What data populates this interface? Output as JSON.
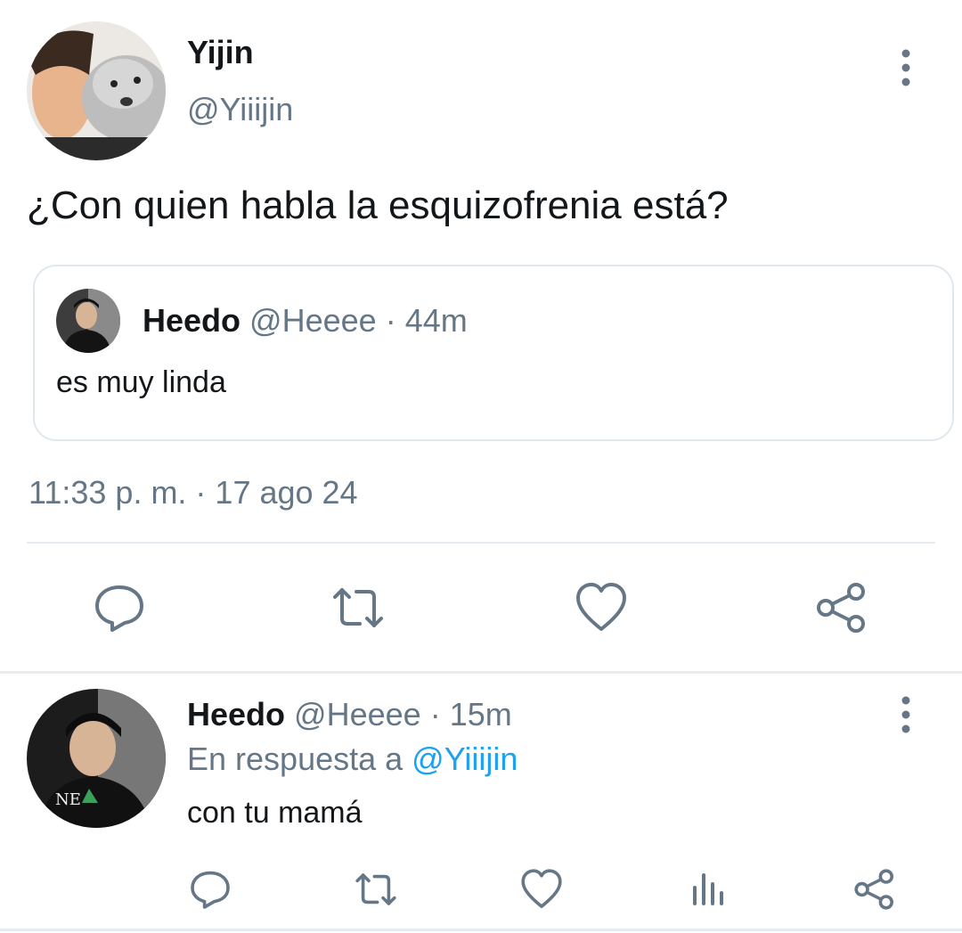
{
  "colors": {
    "text": "#14171a",
    "muted": "#657786",
    "accent": "#1da1f2",
    "border": "#e1e8ed"
  },
  "main_tweet": {
    "display_name": "Yijin",
    "handle": "@Yiiijin",
    "text": "¿Con quien habla la esquizofrenia está?",
    "timestamp": "11:33 p. m. · 17 ago 24",
    "quoted": {
      "display_name": "Heedo",
      "handle": "@Heeee",
      "time": "· 44m",
      "text": "es muy linda"
    },
    "actions": {
      "reply_icon": "reply-icon",
      "retweet_icon": "retweet-icon",
      "like_icon": "heart-icon",
      "share_icon": "share-icon"
    }
  },
  "reply_tweet": {
    "display_name": "Heedo",
    "handle": "@Heeee",
    "time": "· 15m",
    "reply_prefix": "En respuesta a",
    "reply_to": "@Yiiijin",
    "text": "con tu mamá",
    "actions": {
      "reply_icon": "reply-icon",
      "retweet_icon": "retweet-icon",
      "like_icon": "heart-icon",
      "stats_icon": "analytics-icon",
      "share_icon": "share-icon"
    }
  }
}
